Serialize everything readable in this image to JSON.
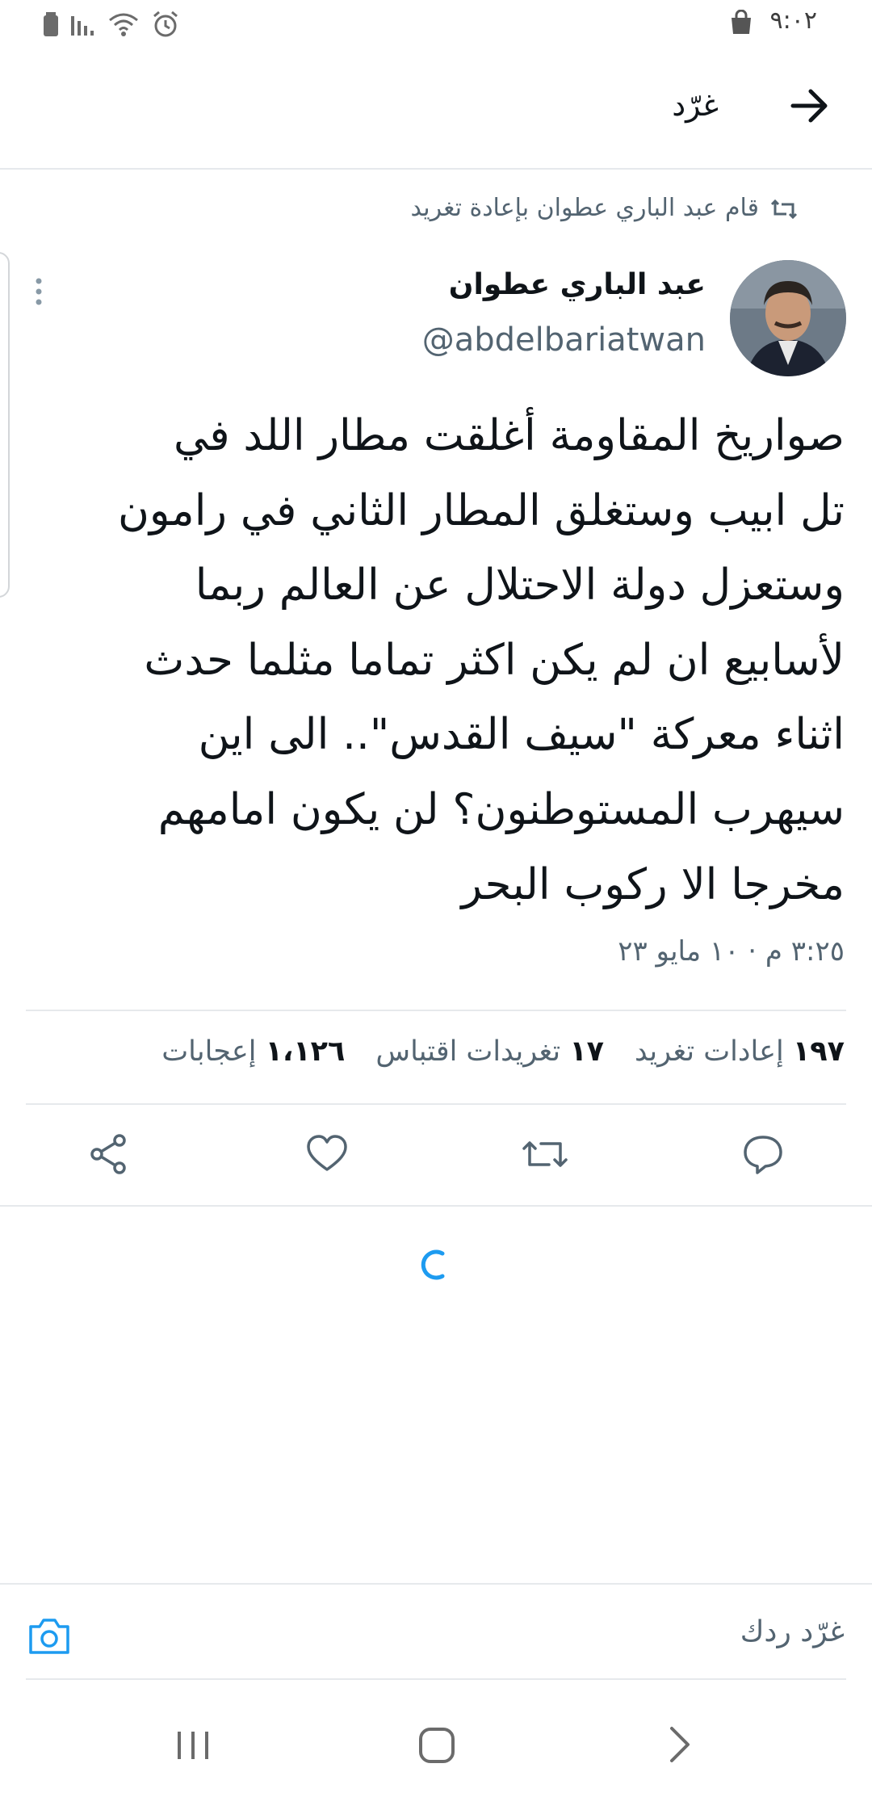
{
  "status_bar": {
    "time": "٩:٠٢"
  },
  "header": {
    "title": "غرّد"
  },
  "retweet_context": {
    "text": "قام عبد الباري عطوان بإعادة تغريد"
  },
  "tweet": {
    "author_name": "عبد الباري عطوان",
    "author_handle": "@abdelbariatwan",
    "lines": [
      "صواريخ المقاومة أغلقت مطار اللد في",
      "تل ابيب وستغلق المطار الثاني في رامون",
      "وستعزل دولة الاحتلال عن العالم ربما",
      "لأسابيع ان لم يكن اكثر تماما مثلما حدث",
      "اثناء معركة \"سيف القدس\".. الى اين",
      "سيهرب المستوطنون؟ لن يكون امامهم",
      "مخرجا الا ركوب البحر"
    ],
    "timestamp": "٣:٢٥ م · ١٠ مايو ٢٣"
  },
  "stats": {
    "retweets_count": "١٩٧",
    "retweets_label": "إعادات تغريد",
    "quotes_count": "١٧",
    "quotes_label": "تغريدات اقتباس",
    "likes_count": "١،١٢٦",
    "likes_label": "إعجابات"
  },
  "composer": {
    "placeholder": "غرّد ردك"
  },
  "colors": {
    "accent": "#1d9bf0",
    "secondary_text": "#536471",
    "divider": "#e6e9ec"
  },
  "icons": [
    "back-arrow-icon",
    "retweet-icon",
    "more-icon",
    "reply-icon",
    "like-icon",
    "share-icon",
    "camera-icon",
    "loading-spinner-icon"
  ]
}
